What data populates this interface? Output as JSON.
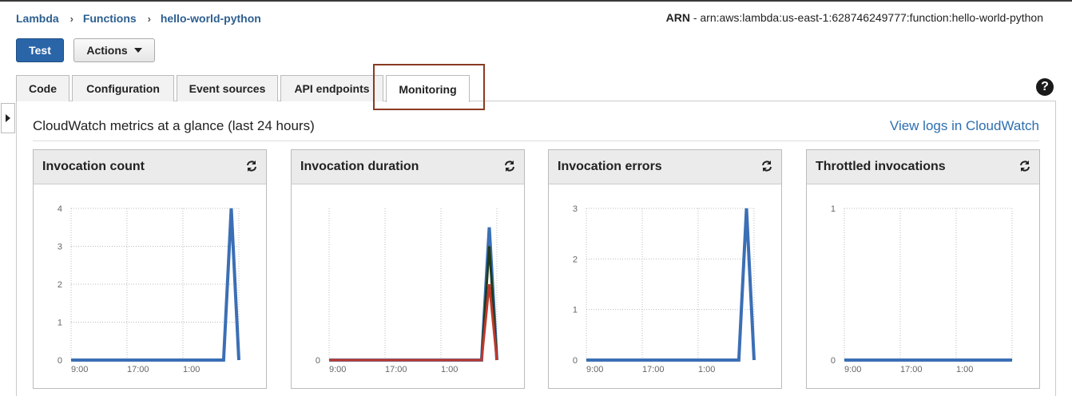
{
  "breadcrumb": {
    "items": [
      "Lambda",
      "Functions",
      "hello-world-python"
    ]
  },
  "arn": {
    "label": "ARN",
    "value": "arn:aws:lambda:us-east-1:628746249777:function:hello-world-python"
  },
  "toolbar": {
    "test_label": "Test",
    "actions_label": "Actions"
  },
  "tabs": [
    "Code",
    "Configuration",
    "Event sources",
    "API endpoints",
    "Monitoring"
  ],
  "active_tab": "Monitoring",
  "help": {
    "glyph": "?"
  },
  "section": {
    "title": "CloudWatch metrics at a glance (last 24 hours)",
    "link": "View logs in CloudWatch"
  },
  "colors": {
    "primary": "#2a65a8",
    "link": "#2d6fb0",
    "series_blue": "#3b6fb5",
    "series_green": "#1f3a1f",
    "series_red": "#c0392b",
    "highlight": "#8b3a22"
  },
  "cards": [
    {
      "title": "Invocation count",
      "refresh_icon": "refresh-icon"
    },
    {
      "title": "Invocation duration",
      "refresh_icon": "refresh-icon"
    },
    {
      "title": "Invocation errors",
      "refresh_icon": "refresh-icon"
    },
    {
      "title": "Throttled invocations",
      "refresh_icon": "refresh-icon"
    }
  ],
  "chart_data": [
    {
      "type": "line",
      "title": "Invocation count",
      "x_ticks": [
        "9:00",
        "17:00",
        "1:00"
      ],
      "y_ticks": [
        "0",
        "1",
        "2",
        "3",
        "4"
      ],
      "ylim": [
        0,
        4
      ],
      "series": [
        {
          "values": [
            0,
            0,
            0,
            0,
            0,
            0,
            0,
            0,
            0,
            0,
            0,
            0,
            0,
            0,
            0,
            0,
            0,
            0,
            0,
            0,
            0,
            4,
            0
          ]
        }
      ]
    },
    {
      "type": "line",
      "title": "Invocation duration",
      "x_ticks": [
        "9:00",
        "17:00",
        "1:00"
      ],
      "y_ticks": [
        "0"
      ],
      "ylim": [
        0,
        4
      ],
      "series": [
        {
          "values": [
            0,
            0,
            0,
            0,
            0,
            0,
            0,
            0,
            0,
            0,
            0,
            0,
            0,
            0,
            0,
            0,
            0,
            0,
            0,
            0,
            0,
            3.5,
            0
          ]
        },
        {
          "values": [
            0,
            0,
            0,
            0,
            0,
            0,
            0,
            0,
            0,
            0,
            0,
            0,
            0,
            0,
            0,
            0,
            0,
            0,
            0,
            0,
            0,
            3.0,
            0
          ]
        },
        {
          "values": [
            0,
            0,
            0,
            0,
            0,
            0,
            0,
            0,
            0,
            0,
            0,
            0,
            0,
            0,
            0,
            0,
            0,
            0,
            0,
            0,
            0,
            2.0,
            0
          ]
        }
      ]
    },
    {
      "type": "line",
      "title": "Invocation errors",
      "x_ticks": [
        "9:00",
        "17:00",
        "1:00"
      ],
      "y_ticks": [
        "0",
        "1",
        "2",
        "3"
      ],
      "ylim": [
        0,
        3
      ],
      "series": [
        {
          "values": [
            0,
            0,
            0,
            0,
            0,
            0,
            0,
            0,
            0,
            0,
            0,
            0,
            0,
            0,
            0,
            0,
            0,
            0,
            0,
            0,
            0,
            3,
            0
          ]
        }
      ]
    },
    {
      "type": "line",
      "title": "Throttled invocations",
      "x_ticks": [
        "9:00",
        "17:00",
        "1:00"
      ],
      "y_ticks": [
        "0",
        "1"
      ],
      "ylim": [
        0,
        1
      ],
      "series": [
        {
          "values": [
            0,
            0,
            0,
            0,
            0,
            0,
            0,
            0,
            0,
            0,
            0,
            0,
            0,
            0,
            0,
            0,
            0,
            0,
            0,
            0,
            0,
            0,
            0
          ]
        }
      ]
    }
  ]
}
